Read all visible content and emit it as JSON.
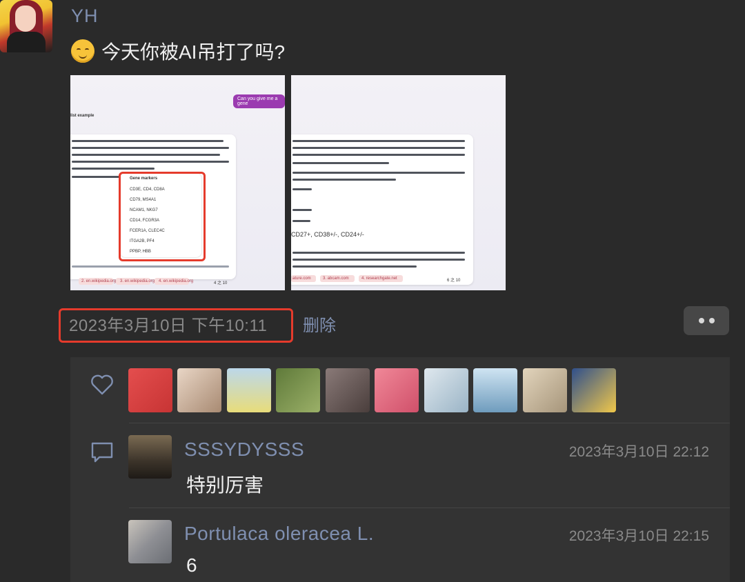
{
  "post": {
    "author": "YH",
    "text": "今天你被AI吊打了吗?",
    "emoji": "smiling-face-icon",
    "timestamp": "2023年3月10日 下午10:11",
    "delete_label": "删除"
  },
  "screenshots": [
    {
      "bubble": "Can you give me a gene",
      "heading": "list example",
      "table_header": "Gene markers",
      "table_rows": [
        "CD3E, CD4, CD8A",
        "CD79, MS4A1",
        "NCAM1, NKG7",
        "CD14, FCGR3A",
        "FCER1A, CLEC4C",
        "ITGA2B, PF4",
        "PPBP, HBB"
      ],
      "counter": "4 之 10",
      "links": [
        "2. en.wikipedia.org",
        "3. en.wikipedia.org",
        "4. en.wikipedia.org"
      ]
    },
    {
      "text_lines": [
        "CD27+, CD38+/-, CD24+/-"
      ],
      "counter": "6 之 10",
      "links": [
        "ature.com",
        "3. abcam.com",
        "4. researchgate.net"
      ]
    }
  ],
  "likes": {
    "icon": "heart-icon",
    "avatar_colors": [
      "#d94a4a",
      "#c9a48c",
      "#9fc3d9",
      "#6f8a4a",
      "#6e5d5a",
      "#e36a7a",
      "#b0c8d8",
      "#7fa9c4",
      "#c9b79a",
      "#3c5c9c"
    ]
  },
  "comments": [
    {
      "name": "SSSYDYSSS",
      "time": "2023年3月10日 22:12",
      "text": "特别厉害"
    },
    {
      "name": "Portulaca oleracea L.",
      "time": "2023年3月10日 22:15",
      "text": "6"
    }
  ]
}
